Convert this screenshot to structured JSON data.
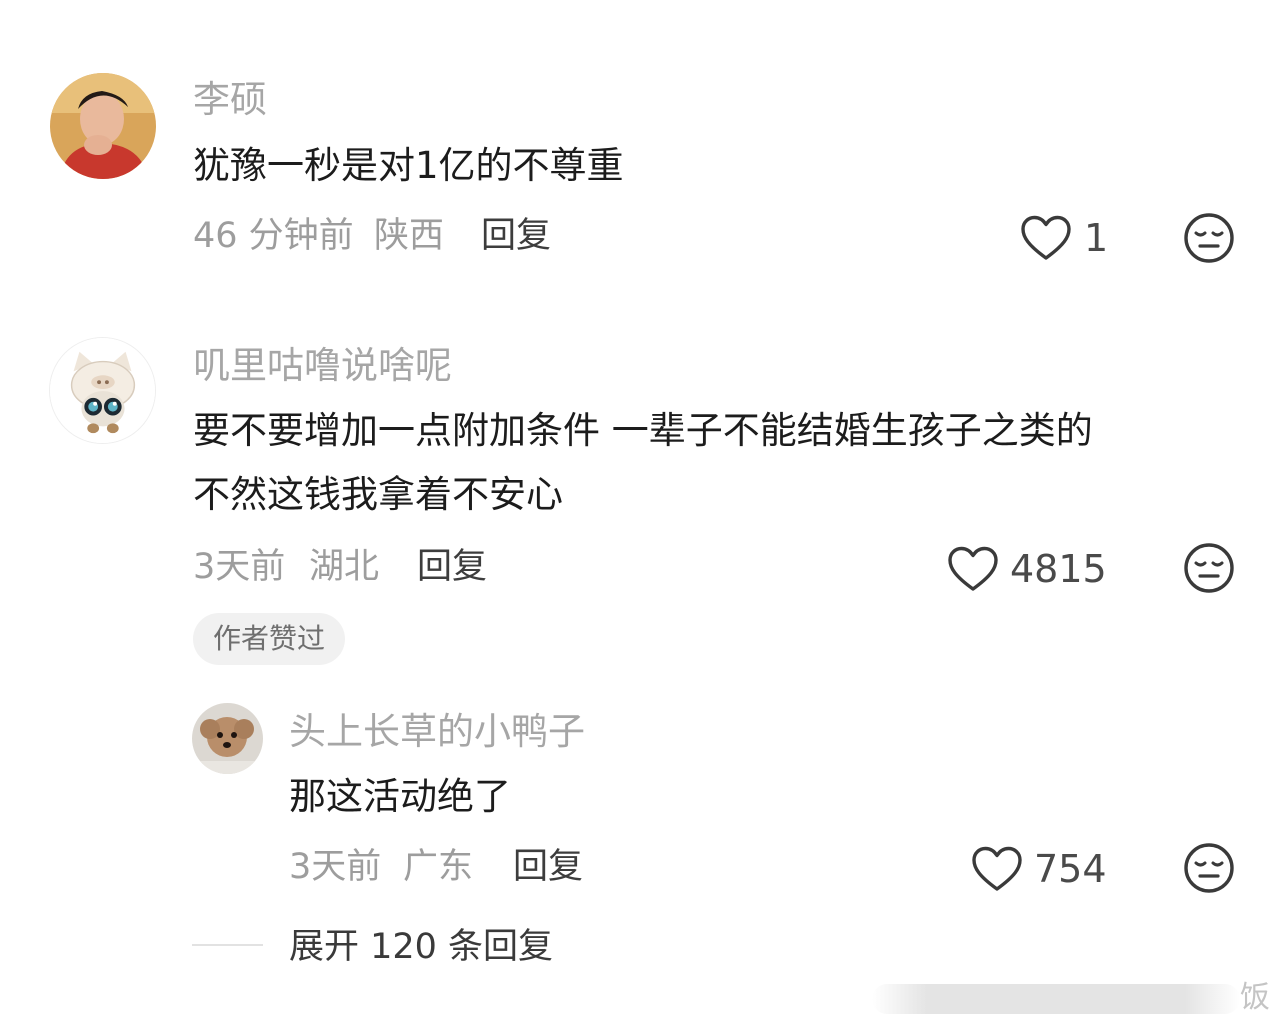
{
  "comments": [
    {
      "username": "李硕",
      "content_lines": [
        "犹豫一秒是对1亿的不尊重"
      ],
      "time": "46 分钟前",
      "location": "陕西",
      "reply_label": "回复",
      "like_count": "1"
    },
    {
      "username": "叽里咕噜说啥呢",
      "content_lines": [
        "要不要增加一点附加条件 一辈子不能结婚生孩子之类的",
        "不然这钱我拿着不安心"
      ],
      "time": "3天前",
      "location": "湖北",
      "reply_label": "回复",
      "like_count": "4815",
      "badge": "作者赞过",
      "replies": [
        {
          "username": "头上长草的小鸭子",
          "content_lines": [
            "那这活动绝了"
          ],
          "time": "3天前",
          "location": "广东",
          "reply_label": "回复",
          "like_count": "754"
        }
      ],
      "expand_label": "展开 120 条回复"
    }
  ],
  "watermark": "饭",
  "icons": {
    "like": "heart-outline-icon",
    "dislike": "neutral-face-icon"
  },
  "colors": {
    "username": "#a6a6a6",
    "content": "#1c1c1c",
    "meta": "#9d9d9d",
    "reply": "#3d3d3d",
    "icon": "#3a3a3a"
  }
}
